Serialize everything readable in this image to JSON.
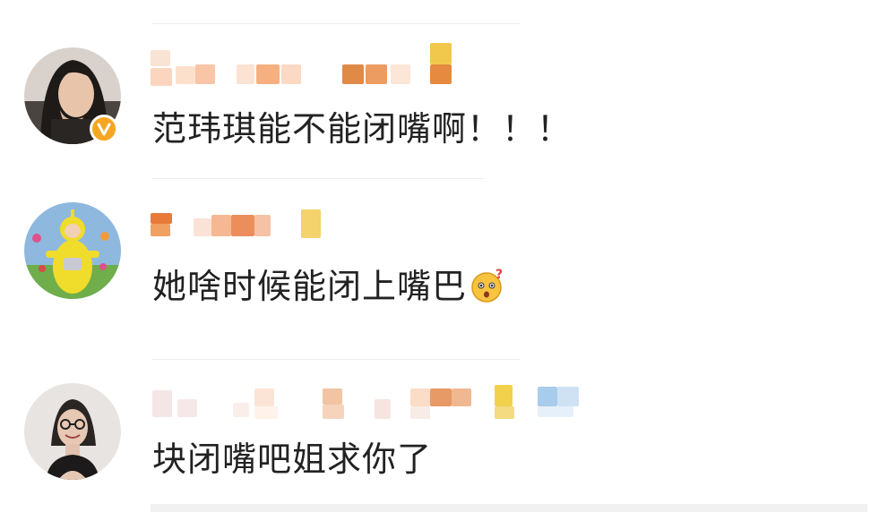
{
  "comments": [
    {
      "text": "范玮琪能不能闭嘴啊！！！",
      "verified": true,
      "avatar_icon": "avatar-woman-photo"
    },
    {
      "text": "她啥时候能闭上嘴巴",
      "emoji": "thinking-face-emoji",
      "avatar_icon": "avatar-teletubby-photo"
    },
    {
      "text": "块闭嘴吧姐求你了",
      "avatar_icon": "avatar-woman-glasses-photo"
    }
  ],
  "colors": {
    "verified_badge": "#f5a623",
    "text": "#222222",
    "divider": "#ececec"
  }
}
